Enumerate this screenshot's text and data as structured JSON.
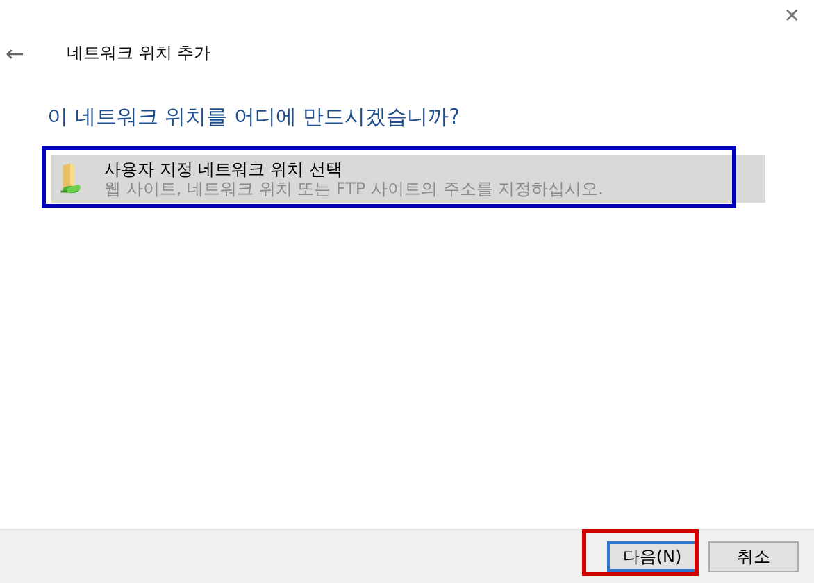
{
  "window": {
    "title": "네트워크 위치 추가",
    "close": "✕",
    "back": "←"
  },
  "heading": "이 네트워크 위치를 어디에 만드시겠습니까?",
  "options": [
    {
      "title": "사용자 지정 네트워크 위치 선택",
      "description": "웹 사이트, 네트워크 위치 또는 FTP 사이트의 주소를 지정하십시오.",
      "selected": true,
      "highlight": {
        "color": "#0000b4"
      }
    }
  ],
  "buttons": [
    {
      "label": "다음(N)",
      "default": true,
      "highlight": {
        "color": "#d40000"
      }
    },
    {
      "label": "취소",
      "default": false
    }
  ]
}
